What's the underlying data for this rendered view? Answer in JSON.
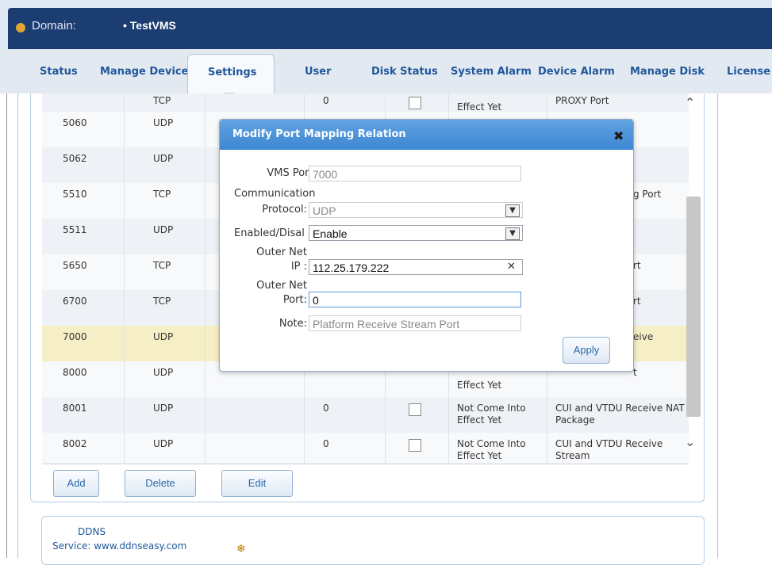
{
  "header": {
    "domain_label": "Domain:",
    "domain_value": "• TestVMS"
  },
  "nav": {
    "tabs": [
      {
        "label": "Status"
      },
      {
        "label": "Manage Device"
      },
      {
        "label": "Settings",
        "active": true
      },
      {
        "label": "User"
      },
      {
        "label": "Disk Status"
      },
      {
        "label": "System Alarm"
      },
      {
        "label": "Device Alarm"
      },
      {
        "label": "Manage Disk"
      },
      {
        "label": "License"
      }
    ]
  },
  "table": {
    "rows": [
      {
        "port": "5060",
        "protocol": "UDP",
        "outer_port": "",
        "status": "",
        "note": ""
      },
      {
        "port": "5062",
        "protocol": "UDP",
        "outer_port": "",
        "status": "",
        "note": ""
      },
      {
        "port": "5510",
        "protocol": "TCP",
        "outer_port": "",
        "status": "",
        "note": "g Port"
      },
      {
        "port": "5511",
        "protocol": "UDP",
        "outer_port": "",
        "status": "",
        "note": ""
      },
      {
        "port": "5650",
        "protocol": "TCP",
        "outer_port": "",
        "status": "",
        "note": "rt"
      },
      {
        "port": "6700",
        "protocol": "TCP",
        "outer_port": "",
        "status": "",
        "note": "rt"
      },
      {
        "port": "7000",
        "protocol": "UDP",
        "outer_port": "",
        "status": "",
        "note": "eive",
        "selected": true
      },
      {
        "port": "8000",
        "protocol": "UDP",
        "outer_port": "",
        "status": "Effect Yet",
        "note": "t"
      },
      {
        "port": "8001",
        "protocol": "UDP",
        "outer_port": "0",
        "status": "Not Come Into Effect Yet",
        "note": "CUI and VTDU Receive NAT Package"
      },
      {
        "port": "8002",
        "protocol": "UDP",
        "outer_port": "0",
        "status": "Not Come Into Effect Yet",
        "note": "CUI and VTDU Receive Stream"
      }
    ],
    "top_partial": {
      "protocol": "TCP",
      "outer_port": "0",
      "status": "Effect Yet",
      "note": "PROXY Port"
    }
  },
  "buttons": {
    "add": "Add",
    "delete": "Delete",
    "edit": "Edit"
  },
  "ddns": {
    "title": "DDNS",
    "service": "Service: www.ddnseasy.com"
  },
  "dialog": {
    "title": "Modify Port Mapping Relation",
    "vms_port_label": "VMS Port:",
    "vms_port_value": "7000",
    "comm_label_1": "Communication",
    "comm_label_2": "Protocol:",
    "protocol_value": "UDP",
    "enabled_label": "Enabled/Disal",
    "enabled_value": "Enable",
    "outer_ip_label_1": "Outer Net",
    "outer_ip_label_2": "IP :",
    "outer_ip_value": "112.25.179.222",
    "outer_port_label_1": "Outer Net",
    "outer_port_label_2": "Port:",
    "outer_port_value": "0",
    "note_label": "Note:",
    "note_value": "Platform Receive Stream Port",
    "apply_label": "Apply"
  },
  "colors": {
    "header_bg": "#1c3d72",
    "dialog_header": "#4a92d8",
    "selected_row": "#f6efc6"
  }
}
